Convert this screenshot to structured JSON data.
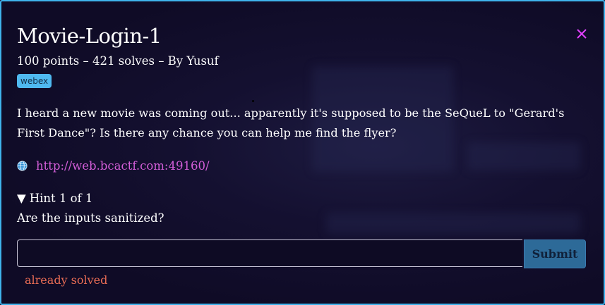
{
  "challenge": {
    "title": "Movie-Login-1",
    "meta": "100 points – 421 solves – By Yusuf",
    "tag": "webex",
    "description": "I heard a new movie was coming out... apparently it's supposed to be the SeQueL to \"Gerard's First Dance\"? Is there any chance you can help me find the flyer?",
    "link": "http://web.bcactf.com:49160/",
    "link_icon": "globe-icon",
    "close_icon": "close-icon"
  },
  "hint": {
    "header": "Hint 1 of 1",
    "toggle_icon": "▼",
    "text": "Are the inputs sanitized?"
  },
  "form": {
    "input_value": "",
    "submit_label": "Submit",
    "status": "already solved"
  },
  "colors": {
    "border": "#3fb3ec",
    "link": "#d35ed8",
    "tag_bg": "#4fb9f0",
    "submit_bg": "#2d6a98",
    "status": "#ea6d55",
    "close": "#e040fb"
  }
}
